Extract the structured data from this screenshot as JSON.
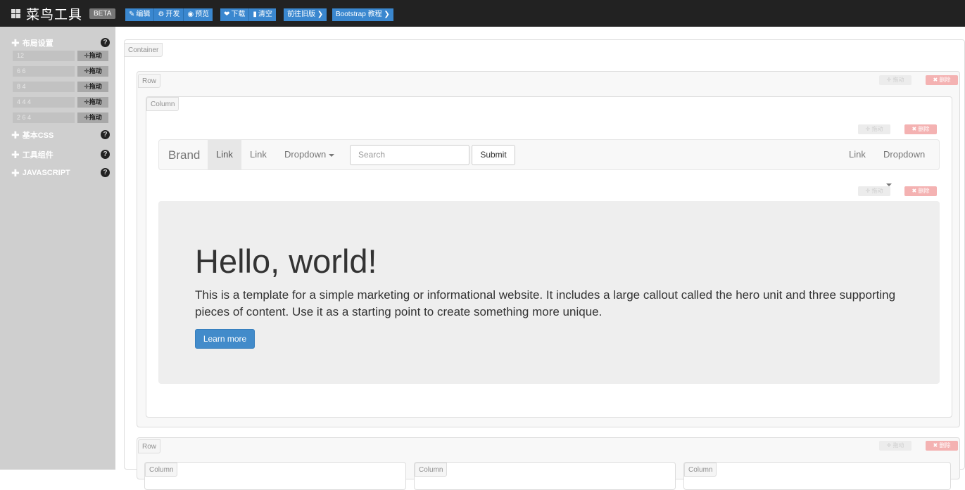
{
  "app": {
    "title": "菜鸟工具",
    "badge": "BETA"
  },
  "toolbar": {
    "group1": [
      {
        "icon": "edit-icon",
        "glyph": "✎",
        "label": "编辑"
      },
      {
        "icon": "dev-icon",
        "glyph": "⚙",
        "label": "开发"
      },
      {
        "icon": "eye-icon",
        "glyph": "◉",
        "label": "预览"
      }
    ],
    "group2": [
      {
        "icon": "download-icon",
        "glyph": "❤",
        "label": "下载"
      },
      {
        "icon": "trash-icon",
        "glyph": "🗑",
        "label": "清空"
      }
    ],
    "old_version": "前往旧版",
    "tutorial": "Bootstrap 教程"
  },
  "sidebar": {
    "section_layout": "布局设置",
    "grid_rows": [
      {
        "value": "12",
        "drag": "拖动"
      },
      {
        "value": "6 6",
        "drag": "拖动"
      },
      {
        "value": "8 4",
        "drag": "拖动"
      },
      {
        "value": "4 4 4",
        "drag": "拖动"
      },
      {
        "value": "2 6 4",
        "drag": "拖动"
      }
    ],
    "section_css": "基本CSS",
    "section_components": "工具组件",
    "section_js": "JAVASCRIPT"
  },
  "canvas": {
    "container_label": "Container",
    "row_label": "Row",
    "column_label": "Column",
    "drag_label": "拖动",
    "delete_label": "删除"
  },
  "navbar": {
    "brand": "Brand",
    "link_active": "Link",
    "link2": "Link",
    "dropdown": "Dropdown",
    "search_placeholder": "Search",
    "submit": "Submit",
    "right_link": "Link",
    "right_dropdown": "Dropdown"
  },
  "jumbotron": {
    "heading": "Hello, world!",
    "text": "This is a template for a simple marketing or informational website. It includes a large callout called the hero unit and three supporting pieces of content. Use it as a starting point to create something more unique.",
    "button": "Learn more"
  },
  "colors": {
    "topbar": "#222222",
    "toolbar_button": "#3a87cf",
    "sidebar": "#cfcfcf",
    "primary_button": "#428bca",
    "delete_button": "#f4b2b2"
  }
}
